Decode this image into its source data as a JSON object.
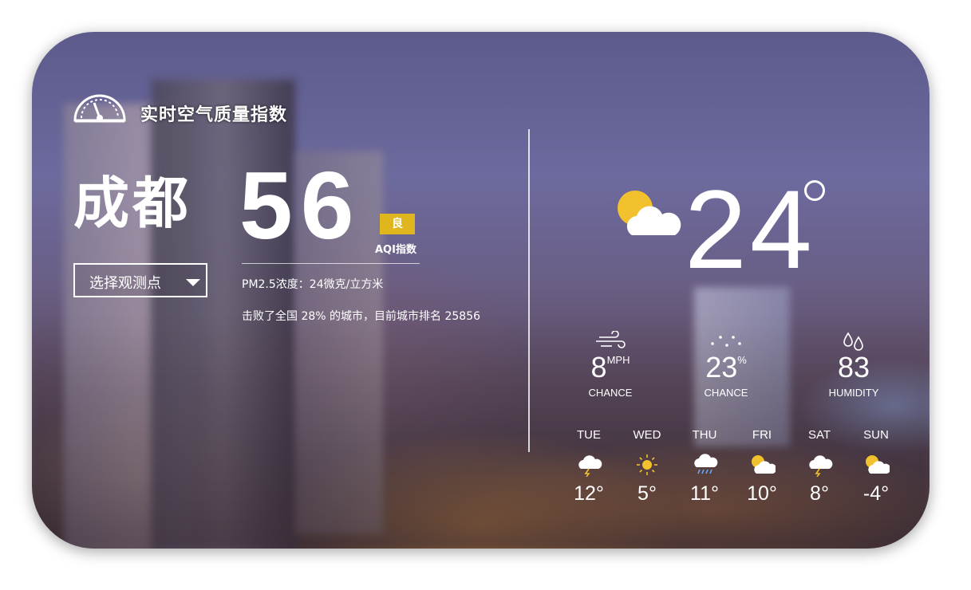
{
  "header": {
    "title": "实时空气质量指数",
    "logo_icon": "gauge-icon"
  },
  "air": {
    "city": "成都",
    "aqi_value": "56",
    "level": "良",
    "level_color": "#e0b61f",
    "aqi_label": "AQI指数",
    "station_button": "选择观测点",
    "pm25": "PM2.5浓度：24微克/立方米",
    "ranking": "击败了全国 28% 的城市，目前城市排名 25856"
  },
  "weather": {
    "current_icon": "partly-cloudy-icon",
    "temperature": "24",
    "stats": [
      {
        "icon": "wind-icon",
        "value": "8",
        "unit": "MPH",
        "label": "CHANCE"
      },
      {
        "icon": "snow-icon",
        "value": "23",
        "unit": "%",
        "label": "CHANCE"
      },
      {
        "icon": "raindrops-icon",
        "value": "83",
        "unit": "",
        "label": "HUMIDITY"
      }
    ],
    "forecast": [
      {
        "day": "TUE",
        "icon": "thunder-cloud-icon",
        "temp": "12°"
      },
      {
        "day": "WED",
        "icon": "sun-icon",
        "temp": "5°"
      },
      {
        "day": "THU",
        "icon": "rain-cloud-icon",
        "temp": "11°"
      },
      {
        "day": "FRI",
        "icon": "partly-cloudy-icon",
        "temp": "10°"
      },
      {
        "day": "SAT",
        "icon": "thunder-cloud-icon",
        "temp": "8°"
      },
      {
        "day": "SUN",
        "icon": "partly-cloudy-icon",
        "temp": "-4°"
      }
    ]
  }
}
